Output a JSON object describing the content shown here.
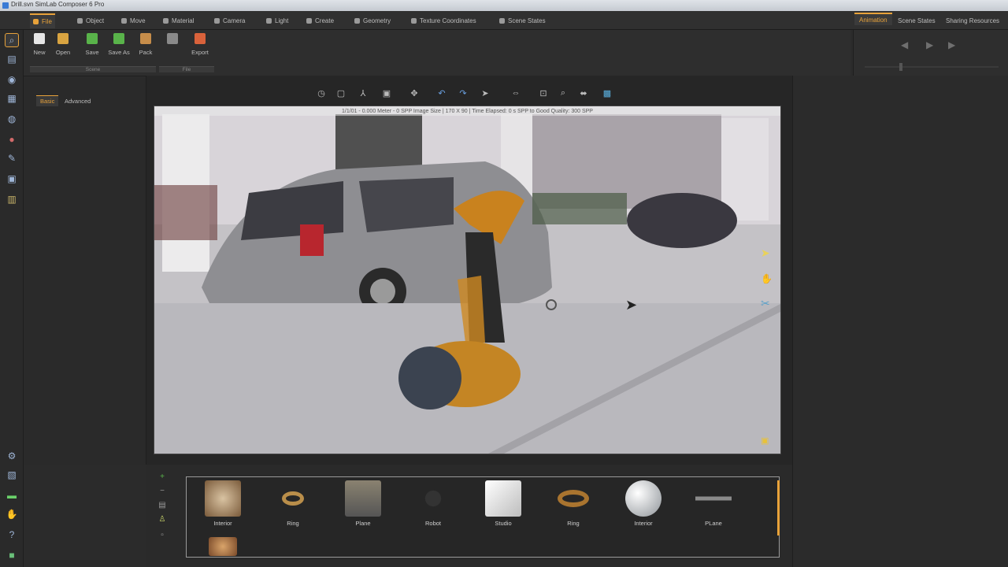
{
  "window": {
    "title": "Drill.svn SimLab Composer 6 Pro"
  },
  "menu": [
    {
      "label": "File",
      "active": true,
      "icon": "file-icon"
    },
    {
      "label": "Object",
      "icon": "object-icon"
    },
    {
      "label": "Move",
      "icon": "move-icon"
    },
    {
      "label": "Material",
      "icon": "material-icon"
    },
    {
      "label": "Camera",
      "icon": "camera-icon"
    },
    {
      "label": "Light",
      "icon": "light-icon"
    },
    {
      "label": "Create",
      "icon": "create-icon"
    },
    {
      "label": "Geometry",
      "icon": "geometry-icon"
    },
    {
      "label": "Texture Coordinates",
      "icon": "texture-icon"
    },
    {
      "label": "Scene States",
      "icon": "scene-states-icon"
    }
  ],
  "right_tabs": [
    {
      "label": "Animation",
      "active": true
    },
    {
      "label": "Scene States"
    },
    {
      "label": "Sharing Resources"
    }
  ],
  "ribbon": {
    "buttons": [
      {
        "label": "New",
        "icon": "new-file-icon",
        "color": "#e6e6e6"
      },
      {
        "label": "Open",
        "icon": "folder-open-icon",
        "color": "#d9a441"
      },
      {
        "label": "Save",
        "icon": "save-icon",
        "color": "#59b34a"
      },
      {
        "label": "Save As",
        "icon": "save-as-icon",
        "color": "#59b34a"
      },
      {
        "label": "Pack",
        "icon": "pack-icon",
        "color": "#c68d4a"
      },
      {
        "label": "",
        "icon": "import-icon",
        "color": "#8a8a8a"
      },
      {
        "label": "Export",
        "icon": "export-icon",
        "color": "#d9623b"
      }
    ],
    "groups": [
      "Scene",
      "File"
    ]
  },
  "side_panel": {
    "tabs": [
      {
        "label": "Basic",
        "active": true
      },
      {
        "label": "Advanced"
      }
    ]
  },
  "viewport": {
    "status": "1/1/01 - 0.000 Meter - 0 SPP    Image Size | 170 X 90 |  Time Elapsed: 0 s   SPP to Good Quality: 300 SPP"
  },
  "library": {
    "items": [
      {
        "label": "Interior",
        "icon": "interior-scene-icon",
        "color": "#a07a52"
      },
      {
        "label": "Ring",
        "icon": "ring-icon",
        "color": "#b98e4a"
      },
      {
        "label": "Plane",
        "icon": "plane-icon",
        "color": "#8a8270"
      },
      {
        "label": "Robot",
        "icon": "robot-icon",
        "color": "#333333"
      },
      {
        "label": "Studio",
        "icon": "studio-icon",
        "color": "#e4e4e4"
      },
      {
        "label": "Ring",
        "icon": "ring-icon",
        "color": "#a9742f"
      },
      {
        "label": "Interior",
        "icon": "interior-sphere-icon",
        "color": "#bfc3c7"
      },
      {
        "label": "PLane",
        "icon": "plane-icon",
        "color": "#7a7a7a"
      }
    ]
  },
  "colors": {
    "accent": "#e8a23a",
    "background": "#2b2b2b"
  }
}
